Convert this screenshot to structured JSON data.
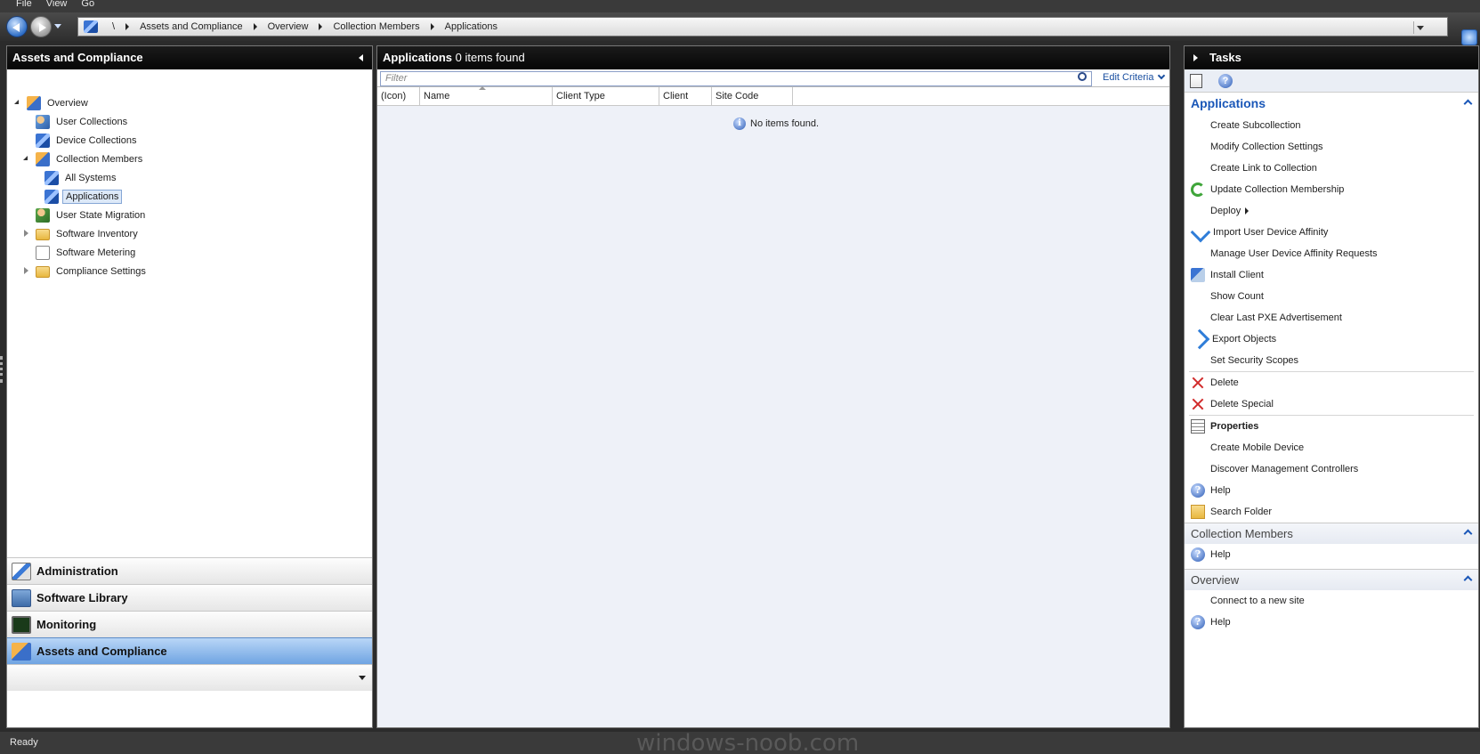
{
  "menu": {
    "items": [
      "File",
      "View",
      "Go"
    ]
  },
  "address": {
    "root": "\\",
    "crumbs": [
      "Assets and Compliance",
      "Overview",
      "Collection Members",
      "Applications"
    ]
  },
  "left": {
    "title": "Assets and Compliance",
    "tree": {
      "overview": "Overview",
      "user_collections": "User Collections",
      "device_collections": "Device Collections",
      "collection_members": "Collection Members",
      "all_systems": "All Systems",
      "applications": "Applications",
      "user_state_migration": "User State Migration",
      "software_inventory": "Software Inventory",
      "software_metering": "Software Metering",
      "compliance_settings": "Compliance Settings"
    },
    "workspaces": {
      "administration": "Administration",
      "software_library": "Software Library",
      "monitoring": "Monitoring",
      "assets": "Assets and Compliance"
    }
  },
  "center": {
    "title": "Applications",
    "count_text": "0 items found",
    "filter_placeholder": "Filter",
    "edit_criteria": "Edit Criteria",
    "columns": [
      "(Icon)",
      "Name",
      "Client Type",
      "Client",
      "Site Code"
    ],
    "empty_text": "No items found."
  },
  "tasks": {
    "title": "Tasks",
    "sections": {
      "applications_title": "Applications",
      "items": {
        "create_subcollection": "Create Subcollection",
        "modify_collection_settings": "Modify Collection Settings",
        "create_link": "Create Link to Collection",
        "update_membership": "Update Collection Membership",
        "deploy": "Deploy",
        "import_affinity": "Import User Device Affinity",
        "manage_affinity": "Manage User Device Affinity Requests",
        "install_client": "Install Client",
        "show_count": "Show Count",
        "clear_pxe": "Clear Last PXE Advertisement",
        "export_objects": "Export Objects",
        "set_security_scopes": "Set Security Scopes",
        "delete": "Delete",
        "delete_special": "Delete Special",
        "properties": "Properties",
        "create_mobile": "Create Mobile Device",
        "discover_mgmt": "Discover Management Controllers",
        "help": "Help",
        "search_folder": "Search Folder"
      },
      "collection_members_title": "Collection Members",
      "collection_members_help": "Help",
      "overview_title": "Overview",
      "connect_site": "Connect to a new site",
      "overview_help": "Help"
    }
  },
  "status": {
    "text": "Ready"
  },
  "watermark": "windows-noob.com"
}
